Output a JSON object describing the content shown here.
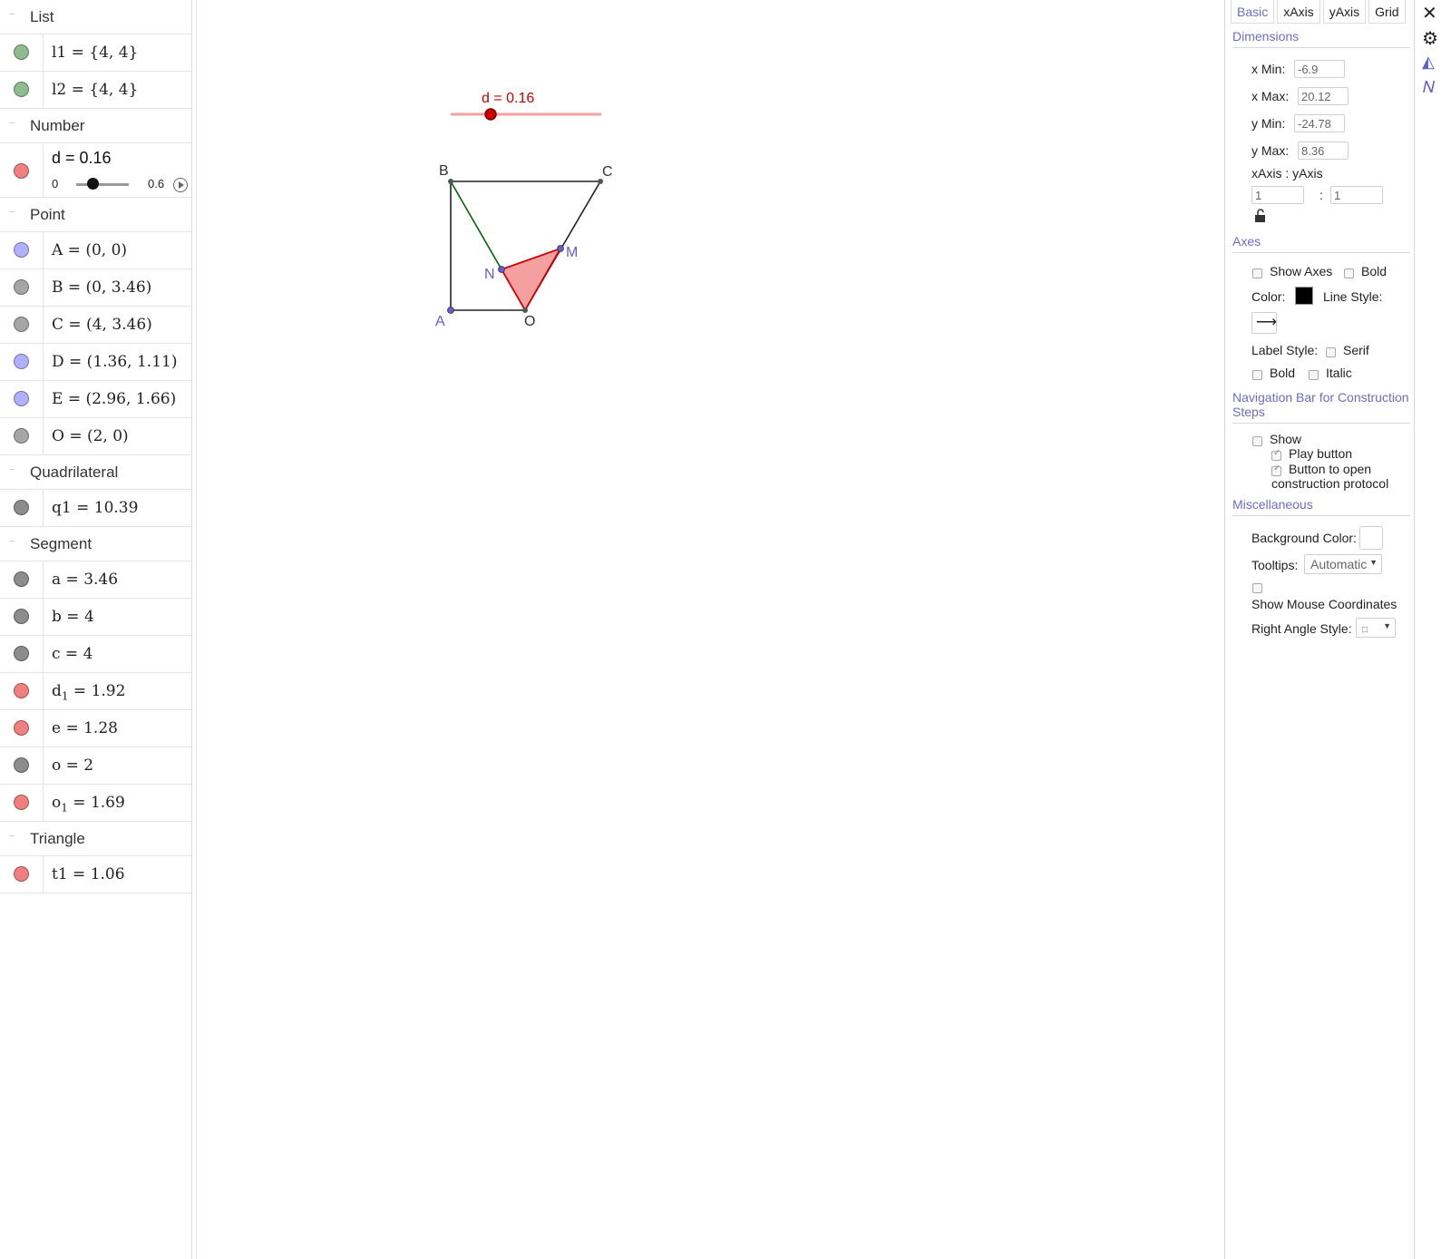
{
  "algebra": {
    "groups": {
      "list": {
        "name": "List"
      },
      "number": {
        "name": "Number"
      },
      "point": {
        "name": "Point"
      },
      "quadrilateral": {
        "name": "Quadrilateral"
      },
      "segment": {
        "name": "Segment"
      },
      "triangle": {
        "name": "Triangle"
      }
    },
    "toggle_glyph": "−",
    "list_items": [
      {
        "expr": "l1 = {4, 4}",
        "color": "#8fbc8f"
      },
      {
        "expr": "l2 = {4, 4}",
        "color": "#8fbc8f"
      }
    ],
    "slider": {
      "label": "d = 0.16",
      "min": "0",
      "max": "0.6",
      "value": 0.16,
      "color": "#f08080"
    },
    "point_items": [
      {
        "expr": "A = (0, 0)",
        "color": "#b0b0ff"
      },
      {
        "expr": "B = (0, 3.46)",
        "color": "#a6a6a6"
      },
      {
        "expr": "C = (4, 3.46)",
        "color": "#a6a6a6"
      },
      {
        "expr": "D = (1.36, 1.11)",
        "color": "#b0b0ff"
      },
      {
        "expr": "E = (2.96, 1.66)",
        "color": "#b0b0ff"
      },
      {
        "expr": "O = (2, 0)",
        "color": "#a6a6a6"
      }
    ],
    "quad_items": [
      {
        "expr": "q1 = 10.39",
        "color": "#8c8c8c"
      }
    ],
    "segment_items": [
      {
        "name": "a",
        "sub": "",
        "value": " = 3.46",
        "color": "#8c8c8c"
      },
      {
        "name": "b",
        "sub": "",
        "value": " = 4",
        "color": "#8c8c8c"
      },
      {
        "name": "c",
        "sub": "",
        "value": " = 4",
        "color": "#8c8c8c"
      },
      {
        "name": "d",
        "sub": "1",
        "value": " = 1.92",
        "color": "#f08080"
      },
      {
        "name": "e",
        "sub": "",
        "value": " = 1.28",
        "color": "#f08080"
      },
      {
        "name": "o",
        "sub": "",
        "value": " = 2",
        "color": "#8c8c8c"
      },
      {
        "name": "o",
        "sub": "1",
        "value": " = 1.69",
        "color": "#f08080"
      }
    ],
    "triangle_items": [
      {
        "expr": "t1 = 1.06",
        "color": "#f08080"
      }
    ]
  },
  "graphics": {
    "slider_label": "d = 0.16",
    "labels": {
      "A": "A",
      "B": "B",
      "C": "C",
      "M": "M",
      "N": "N",
      "O": "O"
    },
    "colors": {
      "slider": "#cc0000",
      "triangle_fill": "#f4a0a0",
      "triangle_stroke": "#cc0000",
      "segment_green": "#006400",
      "point_blue": "#6060d0"
    }
  },
  "props": {
    "tabs": [
      "Basic",
      "xAxis",
      "yAxis",
      "Grid"
    ],
    "dimensions": {
      "title": "Dimensions",
      "xmin_label": "x Min:",
      "xmin": "-6.9",
      "xmax_label": "x Max:",
      "xmax": "20.12",
      "ymin_label": "y Min:",
      "ymin": "-24.78",
      "ymax_label": "y Max:",
      "ymax": "8.36",
      "ratio_label": "xAxis : yAxis",
      "ratio_x": "1",
      "ratio_sep": ":",
      "ratio_y": "1"
    },
    "axes": {
      "title": "Axes",
      "show_axes": "Show Axes",
      "bold": "Bold",
      "color_label": "Color:",
      "line_style_label": "Line Style:",
      "label_style": "Label Style:",
      "serif": "Serif",
      "bold2": "Bold",
      "italic": "Italic",
      "arrow_glyph": "⟶"
    },
    "navbar": {
      "title": "Navigation Bar for Construction Steps",
      "show": "Show",
      "play": "Play button",
      "open_protocol": "Button to open construction protocol"
    },
    "misc": {
      "title": "Miscellaneous",
      "bg_color": "Background Color:",
      "tooltips_label": "Tooltips:",
      "tooltips_value": "Automatic",
      "show_mouse": "Show Mouse Coordinates",
      "right_angle_label": "Right Angle Style:",
      "right_angle_value": "□"
    }
  },
  "side_icons": {
    "close": "✕",
    "gear": "⚙",
    "graph": "◭",
    "func": "𝑁"
  }
}
